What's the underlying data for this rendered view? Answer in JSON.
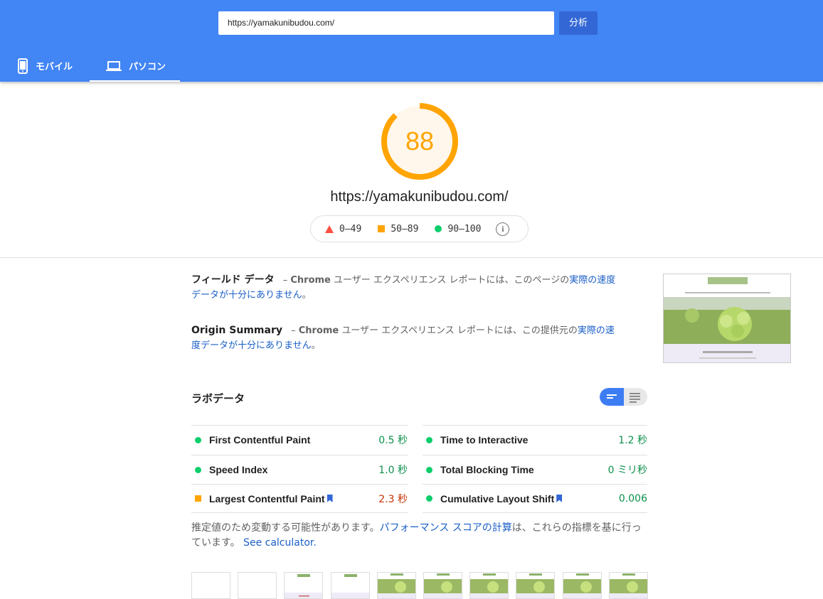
{
  "header": {
    "url_value": "https://yamakunibudou.com/",
    "analyze_label": "分析",
    "tabs": [
      {
        "label": "モバイル",
        "icon": "smartphone-icon"
      },
      {
        "label": "パソコン",
        "icon": "laptop-icon"
      }
    ]
  },
  "score": {
    "value": "88",
    "fraction": 0.88,
    "color": "#ffa400",
    "url": "https://yamakunibudou.com/"
  },
  "legend": [
    {
      "range": "0–49",
      "color": "#ff4e42"
    },
    {
      "range": "50–89",
      "color": "#ffa400"
    },
    {
      "range": "90–100",
      "color": "#0cce6b"
    }
  ],
  "field_data": {
    "title": "フィールド データ",
    "dash": "–",
    "chrome": "Chrome",
    "text": " ユーザー エクスペリエンス レポートには、このページの",
    "link": "実際の速度データが十分にありません",
    "end": "。"
  },
  "origin_summary": {
    "title": "Origin Summary",
    "dash": "–",
    "chrome": "Chrome",
    "text": " ユーザー エクスペリエンス レポートには、この提供元の",
    "link": "実際の速度データが十分にありません",
    "end": "。"
  },
  "lab": {
    "title": "ラボデータ",
    "metrics_left": [
      {
        "name": "First Contentful Paint",
        "value": "0.5 秒",
        "status": "pass"
      },
      {
        "name": "Speed Index",
        "value": "1.0 秒",
        "status": "pass"
      },
      {
        "name": "Largest Contentful Paint",
        "value": "2.3 秒",
        "status": "average"
      }
    ],
    "metrics_right": [
      {
        "name": "Time to Interactive",
        "value": "1.2 秒",
        "status": "pass"
      },
      {
        "name": "Total Blocking Time",
        "value": "0 ミリ秒",
        "status": "pass"
      },
      {
        "name": "Cumulative Layout Shift",
        "value": "0.006",
        "status": "pass"
      }
    ],
    "note_text": "推定値のため変動する可能性があります。",
    "note_link": "パフォーマンス スコアの計算",
    "note_text2": "は、これらの指標を基に行っています。",
    "calculator_link": "See calculator."
  }
}
